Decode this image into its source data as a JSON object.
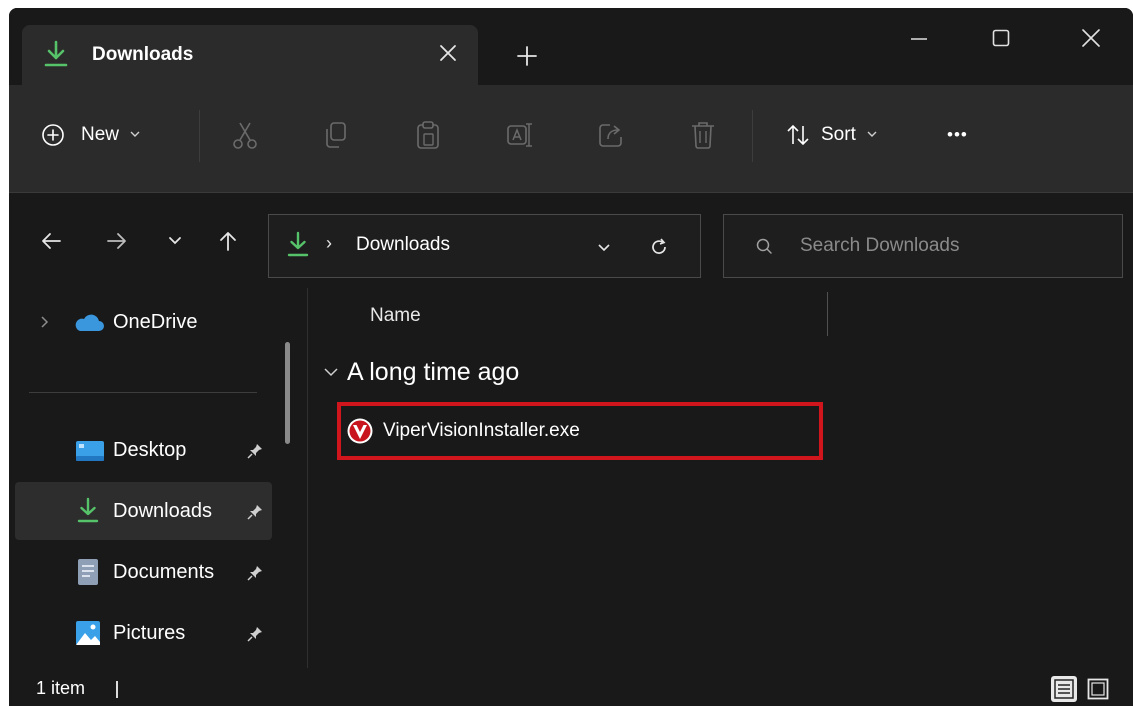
{
  "tab": {
    "title": "Downloads",
    "icon": "download-arrow-icon"
  },
  "window_controls": {
    "minimize": "minimize-icon",
    "maximize": "maximize-icon",
    "close": "close-icon"
  },
  "toolbar": {
    "new_label": "New",
    "sort_label": "Sort",
    "more_label": "•••"
  },
  "address": {
    "path": "Downloads",
    "separator": "›"
  },
  "search": {
    "placeholder": "Search Downloads",
    "value": ""
  },
  "sidebar": {
    "items": [
      {
        "label": "OneDrive",
        "icon": "cloud-icon",
        "pinned": false
      },
      {
        "label": "Desktop",
        "icon": "desktop-icon",
        "pinned": true
      },
      {
        "label": "Downloads",
        "icon": "download-arrow-icon",
        "pinned": true,
        "selected": true
      },
      {
        "label": "Documents",
        "icon": "document-icon",
        "pinned": true
      },
      {
        "label": "Pictures",
        "icon": "pictures-icon",
        "pinned": true
      }
    ]
  },
  "main": {
    "column_name": "Name",
    "group_label": "A long time ago",
    "files": [
      {
        "name": "ViperVisionInstaller.exe",
        "icon": "vipervision-app-icon",
        "highlighted": true
      }
    ]
  },
  "status": {
    "item_count": "1 item"
  },
  "colors": {
    "window_bg": "#191919",
    "toolbar_bg": "#2c2b2b",
    "accent_green": "#56c26a",
    "highlight_red": "#d1151d",
    "onedrive_blue": "#3a96dd"
  }
}
